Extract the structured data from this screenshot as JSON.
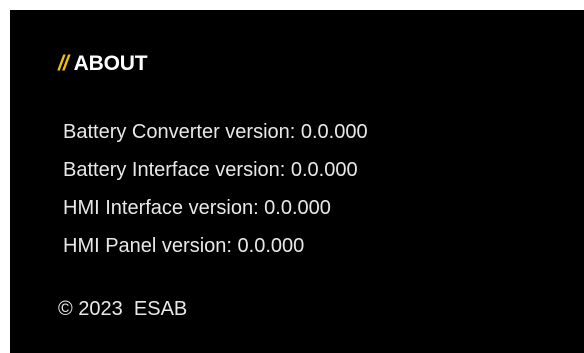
{
  "about": {
    "slashes": "//",
    "title": "ABOUT",
    "accent_color": "#f2c200",
    "background_color": "#000000",
    "lines": [
      "Battery Converter version: 0.0.000",
      "Battery Interface version: 0.0.000",
      "HMI Interface version: 0.0.000",
      "HMI Panel version: 0.0.000"
    ],
    "copyright": "© 2023  ESAB"
  }
}
